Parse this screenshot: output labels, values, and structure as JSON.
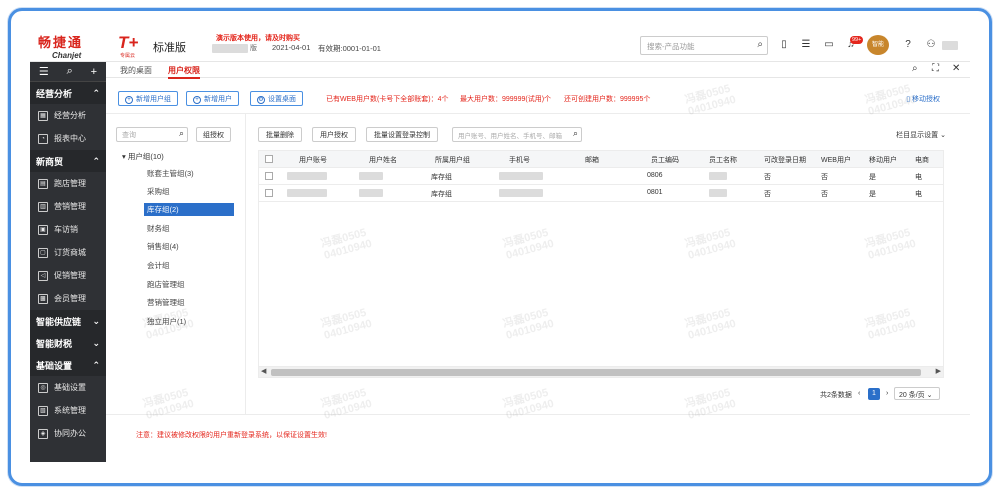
{
  "header": {
    "brand_cn": "畅捷通",
    "brand_en": "Chanjet",
    "product": "T+",
    "product_sub": "专属云",
    "edition": "标准版",
    "demo_note": "演示版本使用，请及时购买",
    "version_suffix": "版",
    "login_date": "2021-04-01",
    "expiry": "有效期:0001-01-01",
    "search_placeholder": "搜索-产品功能",
    "notification_count": "99+",
    "mascot_label": "智能"
  },
  "sidebar": {
    "sections": [
      {
        "label": "经营分析",
        "items": [
          {
            "label": "经营分析",
            "icon": "chart-icon"
          },
          {
            "label": "报表中心",
            "icon": "report-icon"
          }
        ]
      },
      {
        "label": "新商贸",
        "items": [
          {
            "label": "跑店管理",
            "icon": "store-icon"
          },
          {
            "label": "营销管理",
            "icon": "marketing-icon"
          },
          {
            "label": "车访销",
            "icon": "vehicle-icon"
          },
          {
            "label": "订货商城",
            "icon": "mall-icon"
          },
          {
            "label": "促销管理",
            "icon": "promo-icon"
          },
          {
            "label": "会员管理",
            "icon": "member-icon"
          }
        ]
      },
      {
        "label": "智能供应链",
        "items": []
      },
      {
        "label": "智能财税",
        "items": []
      },
      {
        "label": "基础设置",
        "items": [
          {
            "label": "基础设置",
            "icon": "settings-icon"
          },
          {
            "label": "系统管理",
            "icon": "system-icon"
          },
          {
            "label": "协同办公",
            "icon": "collab-icon"
          }
        ]
      }
    ]
  },
  "tabs": [
    {
      "label": "我的桌面"
    },
    {
      "label": "用户权限"
    }
  ],
  "actions": {
    "add_group": "新增用户组",
    "add_user": "新增用户",
    "set_desktop": "设置桌面",
    "stat_web": "已有WEB用户数(卡号下全部账套)：4个",
    "stat_max": "最大用户数：999999(试用)个",
    "stat_remaining": "还可创建用户数：999995个",
    "mobile_auth": "移动授权"
  },
  "groups": {
    "search_placeholder": "查询",
    "assign_btn": "组授权",
    "root": "用户组(10)",
    "nodes": [
      "账套主管组(3)",
      "采购组",
      "库存组(2)",
      "财务组",
      "销售组(4)",
      "会计组",
      "跑店管理组",
      "营销管理组",
      "独立用户(1)"
    ]
  },
  "table": {
    "btn_batch_delete": "批量删除",
    "btn_user_auth": "用户授权",
    "btn_batch_login": "批量设置登录控制",
    "search_placeholder": "用户账号、用户姓名、手机号、邮箱",
    "col_settings": "栏目显示设置",
    "headers": [
      "用户账号",
      "用户姓名",
      "所属用户组",
      "手机号",
      "邮箱",
      "员工编码",
      "员工名称",
      "可改登录日期",
      "WEB用户",
      "移动用户",
      "电商"
    ],
    "rows": [
      {
        "group": "库存组",
        "code": "0806",
        "login": "否",
        "web": "否",
        "mobile": "是",
        "ec": "电"
      },
      {
        "group": "库存组",
        "code": "0801",
        "login": "否",
        "web": "否",
        "mobile": "是",
        "ec": "电"
      }
    ],
    "total": "共2条数据",
    "page": "1",
    "page_size": "20 条/页"
  },
  "notice": "注意：建议被修改权限的用户重新登录系统，以保证设置生效!",
  "watermark": "冯磊0505\n04010940"
}
